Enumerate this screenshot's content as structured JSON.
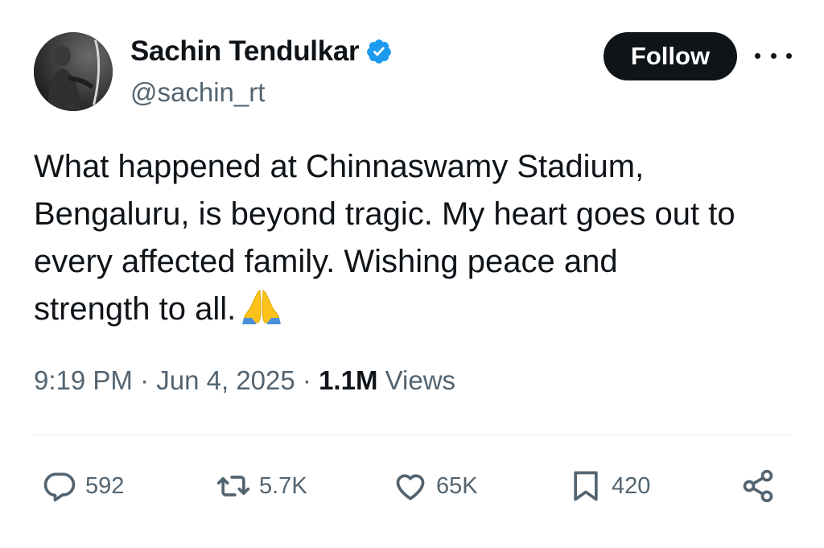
{
  "author": {
    "name": "Sachin Tendulkar",
    "handle": "@sachin_rt",
    "verified": true,
    "verified_color": "#1d9bf0"
  },
  "follow_button": {
    "label": "Follow"
  },
  "tweet": {
    "lines": [
      "What happened at Chinnaswamy Stadium,",
      "Bengaluru, is beyond tragic. My heart goes out to",
      "every affected family. Wishing peace and",
      "strength to all."
    ],
    "emoji": "folded-hands-icon"
  },
  "meta": {
    "time": "9:19 PM",
    "date": "Jun 4, 2025",
    "sep": "·",
    "views_count": "1.1M",
    "views_label": "Views"
  },
  "actions": {
    "replies": "592",
    "reposts": "5.7K",
    "likes": "65K",
    "bookmarks": "420"
  }
}
